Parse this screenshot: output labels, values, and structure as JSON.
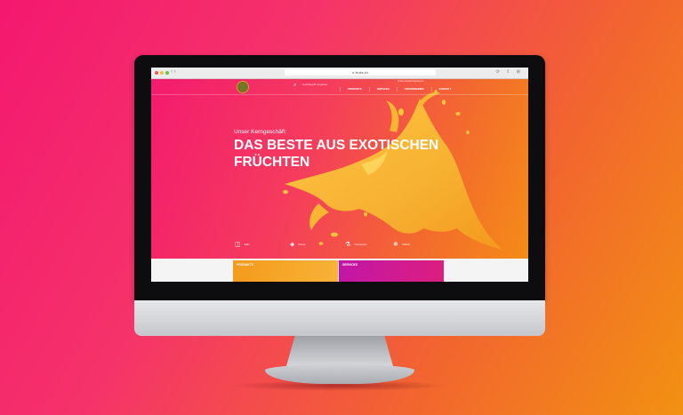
{
  "browser": {
    "url": "e-fruits.ch",
    "chrome_icons": "⟳ ⇪ ⊞"
  },
  "site": {
    "top_links": "Suche  Kontakt  Impressum",
    "search_placeholder": "Suchbegriff eingeben",
    "nav": [
      "PRODUKTE",
      "SERVICES",
      "UNTERNEHMEN",
      "KONTAKT"
    ],
    "eyebrow": "Unser Kerngeschäft:",
    "headline": "DAS BESTE AUS EXOTISCHEN FRÜCHTEN",
    "features": [
      {
        "icon": "glass-icon",
        "glyph": "◫",
        "label": "Säfte"
      },
      {
        "icon": "shield-icon",
        "glyph": "◈",
        "label": "Pürees"
      },
      {
        "icon": "flask-icon",
        "glyph": "⚗",
        "label": "Konzentrate"
      },
      {
        "icon": "snowflake-icon",
        "glyph": "❄",
        "label": "Tiefkühl"
      }
    ],
    "cards": [
      {
        "title": "PRODUKTE"
      },
      {
        "title": "SERVICES"
      }
    ]
  },
  "colors": {
    "background_start": "#f4186f",
    "background_end": "#f29112",
    "juice": "#f7b532",
    "services_card": "#c116a7"
  }
}
